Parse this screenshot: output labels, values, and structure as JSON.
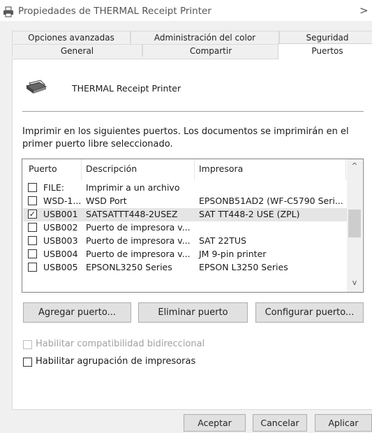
{
  "window": {
    "title": "Propiedades de THERMAL Receipt Printer",
    "close_glyph": ">"
  },
  "tabs_top": [
    {
      "label": "Opciones avanzadas"
    },
    {
      "label": "Administración del color"
    },
    {
      "label": "Seguridad"
    }
  ],
  "tabs_bottom": [
    {
      "label": "General"
    },
    {
      "label": "Compartir"
    },
    {
      "label": "Puertos",
      "active": true
    }
  ],
  "printer": {
    "name": "THERMAL Receipt Printer",
    "icon": "printer-icon"
  },
  "description": "Imprimir en los siguientes puertos. Los documentos se imprimirán en el primer puerto libre seleccionado.",
  "port_list": {
    "headers": {
      "port": "Puerto",
      "description": "Descripción",
      "printer": "Impresora"
    },
    "rows": [
      {
        "port": "FILE:",
        "description": "Imprimir a un archivo",
        "printer": "",
        "checked": false,
        "selected": false
      },
      {
        "port": "WSD-1...",
        "description": "WSD Port",
        "printer": "EPSONB51AD2 (WF-C5790 Seri...",
        "checked": false,
        "selected": false
      },
      {
        "port": "USB001",
        "description": "SATSATTT448-2USEZ",
        "printer": "SAT TT448-2 USE (ZPL)",
        "checked": true,
        "selected": true
      },
      {
        "port": "USB002",
        "description": "Puerto de impresora v...",
        "printer": "",
        "checked": false,
        "selected": false
      },
      {
        "port": "USB003",
        "description": "Puerto de impresora v...",
        "printer": "SAT 22TUS",
        "checked": false,
        "selected": false
      },
      {
        "port": "USB004",
        "description": "Puerto de impresora v...",
        "printer": "JM 9-pin printer",
        "checked": false,
        "selected": false
      },
      {
        "port": "USB005",
        "description": "EPSONL3250 Series",
        "printer": "EPSON L3250 Series",
        "checked": false,
        "selected": false
      }
    ],
    "scroll_up": "^",
    "scroll_down": "v"
  },
  "buttons": {
    "add_port": "Agregar puerto...",
    "delete_port": "Eliminar puerto",
    "configure_port": "Configurar puerto..."
  },
  "options": {
    "bidirectional": {
      "label": "Habilitar compatibilidad bidireccional",
      "checked": false,
      "enabled": false
    },
    "pooling": {
      "label": "Habilitar agrupación de impresoras",
      "checked": false,
      "enabled": true
    }
  },
  "dialog_buttons": {
    "ok": "Aceptar",
    "cancel": "Cancelar",
    "apply": "Aplicar"
  }
}
